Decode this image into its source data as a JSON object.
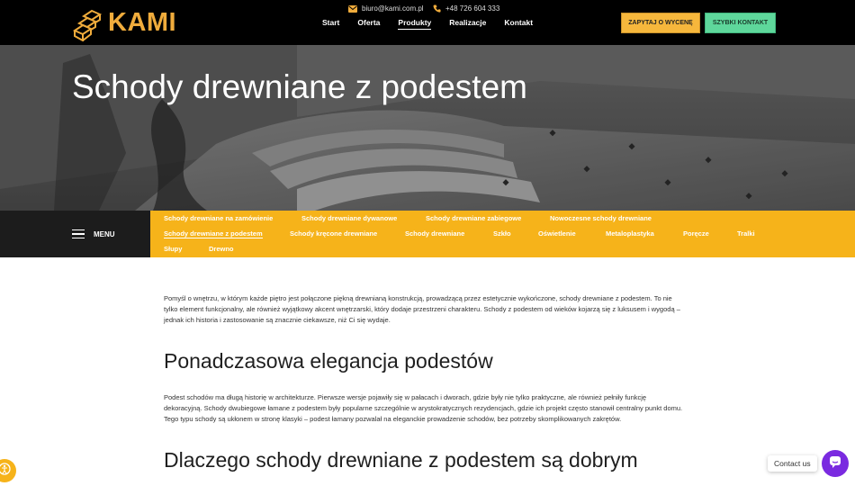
{
  "header": {
    "logo_text": "KAMI",
    "email": "biuro@kami.com.pl",
    "phone": "+48 726 604 333",
    "nav": [
      {
        "label": "Start"
      },
      {
        "label": "Oferta"
      },
      {
        "label": "Produkty",
        "active": true
      },
      {
        "label": "Realizacje"
      },
      {
        "label": "Kontakt"
      }
    ],
    "quote_button": "ZAPYTAJ O WYCENĘ",
    "fast_contact_button": "SZYBKI KONTAKT"
  },
  "hero": {
    "title": "Schody drewniane z podestem"
  },
  "category_bar": {
    "menu_label": "MENU",
    "categories": [
      "Schody drewniane na zamówienie",
      "Schody drewniane dywanowe",
      "Schody drewniane zabiegowe",
      "Nowoczesne schody drewniane",
      "Schody drewniane z podestem",
      "Schody kręcone drewniane",
      "Schody drewniane",
      "Szkło",
      "Oświetlenie",
      "Metaloplastyka",
      "Poręcze",
      "Tralki",
      "Słupy",
      "Drewno"
    ],
    "active": "Schody drewniane z podestem"
  },
  "content": {
    "intro": "Pomyśl o wnętrzu, w którym każde piętro jest połączone piękną drewnianą konstrukcją, prowadzącą przez estetycznie wykończone, schody drewniane z podestem. To nie tylko element funkcjonalny, ale również wyjątkowy akcent wnętrzarski, który dodaje przestrzeni charakteru. Schody z podestem od wieków kojarzą się z luksusem i wygodą – jednak ich historia i zastosowanie są znacznie ciekawsze, niż Ci się wydaje.",
    "heading1": "Ponadczasowa elegancja podestów",
    "paragraph1": "Podest schodów ma długą historię w architekturze. Pierwsze wersje pojawiły się w pałacach i dworach, gdzie były nie tylko praktyczne, ale również pełniły funkcję dekoracyjną. Schody dwubiegowe łamane z podestem były popularne szczególnie w arystokratycznych rezydencjach, gdzie ich projekt często stanowił centralny punkt domu. Tego typu schody są ukłonem w stronę klasyki – podest łamany pozwalał na eleganckie prowadzenie schodów, bez potrzeby skomplikowanych zakrętów.",
    "heading2": "Dlaczego schody drewniane z podestem są dobrym"
  },
  "floating": {
    "contact_us": "Contact us"
  },
  "colors": {
    "accent": "#f6b31a",
    "logo": "#f0ac3c",
    "quote_button": "#f6b73c",
    "fast_button": "#5ed79b",
    "chat": "#7a2ae0"
  }
}
